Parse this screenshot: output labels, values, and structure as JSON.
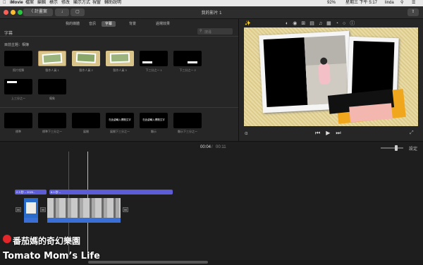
{
  "menubar": {
    "apple": "",
    "app": "iMovie",
    "items": [
      "檔案",
      "編輯",
      "標示",
      "修改",
      "顯示方式",
      "視窗",
      "輔助說明"
    ],
    "battery": "92%",
    "clock": "星期三 下午 5:17",
    "user": "linda"
  },
  "titlebar": {
    "back_label": "〈 計畫案",
    "title": "我的影片 1"
  },
  "browser": {
    "tabs": [
      "我的媒體",
      "音訊",
      "字幕",
      "背景",
      "過場效果"
    ],
    "active_tab": 2,
    "section_title": "字幕",
    "search_placeholder": "搜尋",
    "theme_label": "目前主題：相簿",
    "row1": [
      {
        "label": "照片相簿"
      },
      {
        "label": "製作人員 1"
      },
      {
        "label": "製作人員 2"
      },
      {
        "label": "製作人員 3"
      },
      {
        "label": "下三分之一 1"
      },
      {
        "label": "下三分之一 2"
      }
    ],
    "row2": [
      {
        "label": "上三分之一"
      },
      {
        "label": "備象"
      }
    ],
    "row3": [
      {
        "label": "標準",
        "text": ""
      },
      {
        "label": "標準下三分之一",
        "text": ""
      },
      {
        "label": "展開",
        "text": ""
      },
      {
        "label": "展開下三分之一",
        "text": "在此處輸入標題文字"
      },
      {
        "label": "顯示",
        "text": "在此處輸入標題文字"
      },
      {
        "label": "顯示下三分之一",
        "text": ""
      }
    ]
  },
  "timeline": {
    "current_time": "00:04",
    "separator": "/",
    "total_time": "00:11",
    "settings_label": "設定",
    "clip1_label": "2.3 秒 – 2020...",
    "clip2_label": "8.0 秒 –"
  },
  "watermark": {
    "line1": "番茄媽的奇幻樂園",
    "line2": "Tomato Mom’s Life"
  },
  "colors": {
    "accent": "#5c5cd6",
    "audio": "#3a6fd6"
  }
}
